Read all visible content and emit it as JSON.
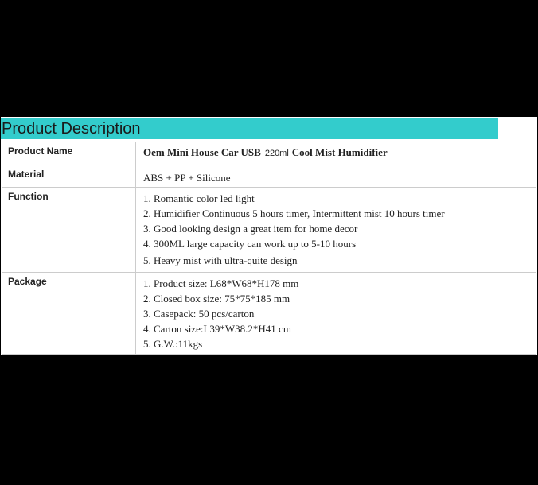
{
  "header": {
    "title": "Product Description"
  },
  "colors": {
    "header_bar": "#33cccc",
    "background": "#000000",
    "panel": "#ffffff",
    "border": "#cccccc"
  },
  "rows": {
    "product_name": {
      "label": "Product Name",
      "value_part1": "Oem Mini House Car USB",
      "value_capacity": "220ml",
      "value_part2": "Cool Mist Humidifier"
    },
    "material": {
      "label": "Material",
      "value": "ABS + PP + Silicone"
    },
    "function": {
      "label": "Function",
      "items": [
        "1. Romantic color led light",
        "2. Humidifier Continuous 5 hours timer, Intermittent mist 10 hours timer",
        "3. Good looking design a great item for home decor",
        "4. 300ML large capacity can work up to 5-10 hours",
        "5. Heavy mist with ultra-quite design"
      ]
    },
    "package": {
      "label": "Package",
      "items": [
        "1. Product size: L68*W68*H178 mm",
        "2. Closed box size: 75*75*185 mm",
        "3. Casepack: 50 pcs/carton",
        "4. Carton size:L39*W38.2*H41 cm",
        "5. G.W.:11kgs"
      ]
    }
  }
}
